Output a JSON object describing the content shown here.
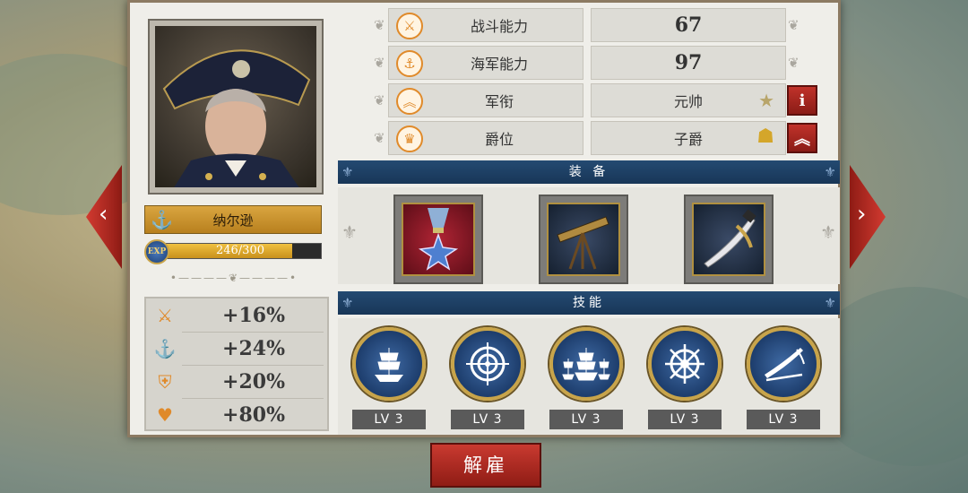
{
  "captain": {
    "name": "纳尔逊",
    "exp_label": "EXP",
    "exp_text": "246/300",
    "exp_fraction": 0.82
  },
  "stats": [
    {
      "label": "战斗能力",
      "value": "67",
      "icon": "crossed-swords-icon"
    },
    {
      "label": "海军能力",
      "value": "97",
      "icon": "anchor-icon"
    },
    {
      "label": "军衔",
      "value": "元帅",
      "icon": "rank-chevron-icon"
    },
    {
      "label": "爵位",
      "value": "子爵",
      "icon": "crown-icon"
    }
  ],
  "rank_info_glyph": "i",
  "bonuses": [
    {
      "value": "+16%",
      "icon": "crossed-swords-icon"
    },
    {
      "value": "+24%",
      "icon": "anchor-icon"
    },
    {
      "value": "+20%",
      "icon": "shield-icon"
    },
    {
      "value": "+80%",
      "icon": "heart-icon"
    }
  ],
  "equipment": {
    "title": "装 备",
    "items": [
      {
        "icon": "medal-icon"
      },
      {
        "icon": "telescope-icon"
      },
      {
        "icon": "saber-icon"
      }
    ]
  },
  "skills": {
    "title": "技能",
    "items": [
      {
        "icon": "ship-icon",
        "level": "LV 3"
      },
      {
        "icon": "target-icon",
        "level": "LV 3"
      },
      {
        "icon": "fleet-icon",
        "level": "LV 3"
      },
      {
        "icon": "ship-wheel-icon",
        "level": "LV 3"
      },
      {
        "icon": "swords-icon",
        "level": "LV 3"
      }
    ]
  },
  "dismiss_label": "解雇",
  "colors": {
    "accent_orange": "#e08a2a",
    "section_blue": "#1f4168",
    "button_red": "#b02a22",
    "gold": "#c8a44a"
  }
}
